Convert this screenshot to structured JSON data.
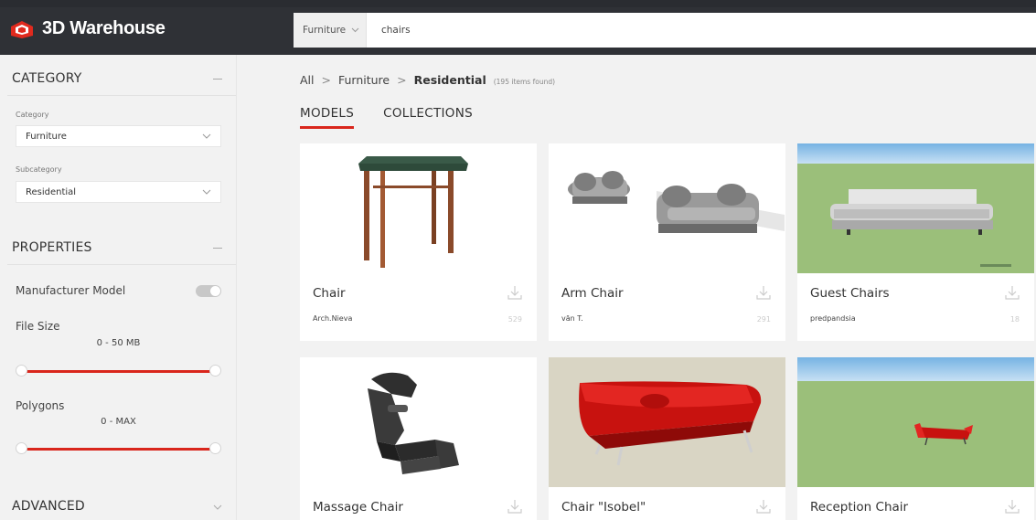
{
  "app": {
    "logo_text": "3D Warehouse"
  },
  "search": {
    "category": "Furniture",
    "query": "chairs"
  },
  "sidebar": {
    "category": {
      "heading": "CATEGORY",
      "category_label": "Category",
      "category_value": "Furniture",
      "subcategory_label": "Subcategory",
      "subcategory_value": "Residential"
    },
    "properties": {
      "heading": "PROPERTIES",
      "manufacturer_label": "Manufacturer Model",
      "manufacturer_on": false,
      "file_size_label": "File Size",
      "file_size_range": "0 - 50 MB",
      "polygons_label": "Polygons",
      "polygons_range": "0 - MAX"
    },
    "advanced": {
      "heading": "ADVANCED"
    }
  },
  "breadcrumb": {
    "all": "All",
    "furniture": "Furniture",
    "current": "Residential",
    "count": "(195 items found)"
  },
  "tabs": [
    {
      "label": "MODELS",
      "active": true
    },
    {
      "label": "COLLECTIONS",
      "active": false
    }
  ],
  "models": [
    {
      "title": "Chair",
      "author": "Arch.Nieva",
      "count": "529"
    },
    {
      "title": "Arm Chair",
      "author": "văn T.",
      "count": "291"
    },
    {
      "title": "Guest Chairs",
      "author": "predpandsia",
      "count": "18"
    },
    {
      "title": "Massage Chair",
      "author": "",
      "count": ""
    },
    {
      "title": "Chair \"Isobel\"",
      "author": "",
      "count": ""
    },
    {
      "title": "Reception Chair",
      "author": "",
      "count": ""
    }
  ],
  "colors": {
    "accent": "#d9261c",
    "topbar": "#2f3136",
    "sky": "#8ec3ea",
    "grass": "#9bbf7a"
  }
}
